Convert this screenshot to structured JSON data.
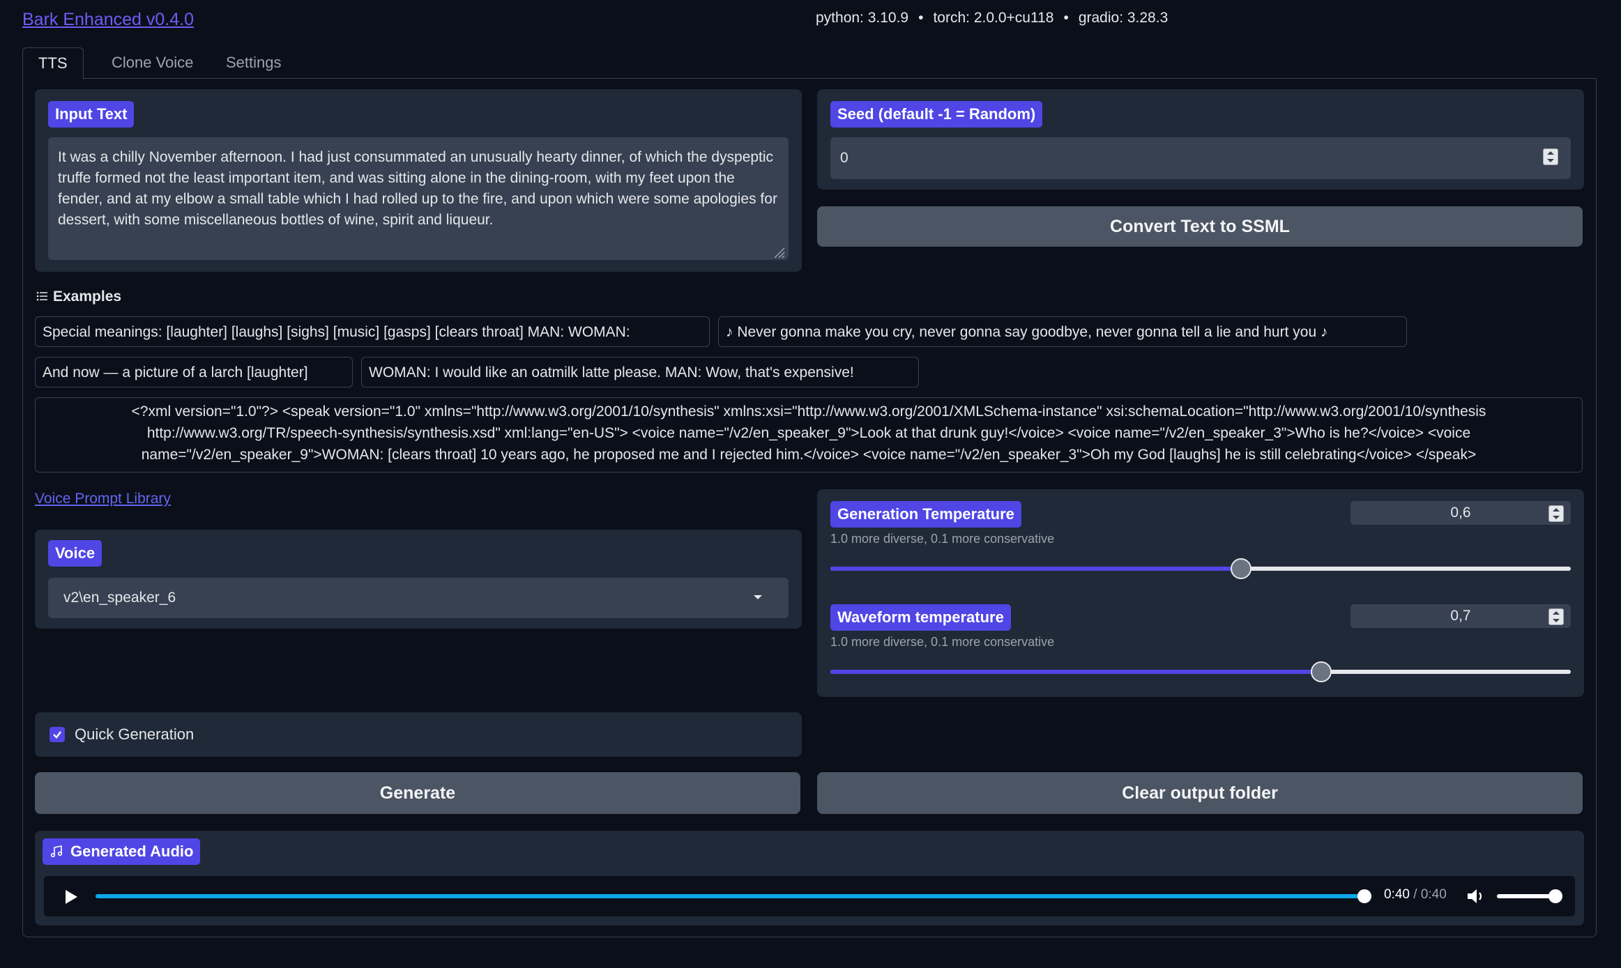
{
  "header": {
    "title": "Bark Enhanced v0.4.0",
    "versions": [
      "python: 3.10.9",
      "torch: 2.0.0+cu118",
      "gradio: 3.28.3"
    ],
    "separator": "•"
  },
  "tabs": [
    {
      "label": "TTS",
      "active": true
    },
    {
      "label": "Clone Voice",
      "active": false
    },
    {
      "label": "Settings",
      "active": false
    }
  ],
  "input_text": {
    "label": "Input Text",
    "value": "It was a chilly November afternoon. I had just consummated an unusually hearty dinner, of which the dyspeptic truffe formed not the least important item, and was sitting alone in the dining-room, with my feet upon the fender, and at my elbow a small table which I had rolled up to the fire, and upon which were some apologies for dessert, with some miscellaneous bottles of wine, spirit and liqueur."
  },
  "seed": {
    "label": "Seed (default -1 = Random)",
    "value": "0"
  },
  "convert_button": "Convert Text to SSML",
  "examples": {
    "label": "Examples",
    "items": [
      "Special meanings: [laughter] [laughs] [sighs] [music] [gasps] [clears throat] MAN: WOMAN:",
      "♪ Never gonna make you cry, never gonna say goodbye, never gonna tell a lie and hurt you ♪",
      "And now — a picture of a larch [laughter]",
      "WOMAN: I would like an oatmilk latte please. MAN: Wow, that's expensive!",
      "<?xml version=\"1.0\"?> <speak version=\"1.0\" xmlns=\"http://www.w3.org/2001/10/synthesis\" xmlns:xsi=\"http://www.w3.org/2001/XMLSchema-instance\" xsi:schemaLocation=\"http://www.w3.org/2001/10/synthesis http://www.w3.org/TR/speech-synthesis/synthesis.xsd\" xml:lang=\"en-US\"> <voice name=\"/v2/en_speaker_9\">Look at that drunk guy!</voice> <voice name=\"/v2/en_speaker_3\">Who is he?</voice> <voice name=\"/v2/en_speaker_9\">WOMAN: [clears throat] 10 years ago, he proposed me and I rejected him.</voice> <voice name=\"/v2/en_speaker_3\">Oh my God [laughs] he is still celebrating</voice> </speak>"
    ]
  },
  "voice_library_link": "Voice Prompt Library",
  "voice": {
    "label": "Voice",
    "selected": "v2\\en_speaker_6"
  },
  "generation_temperature": {
    "label": "Generation Temperature",
    "info": "1.0 more diverse, 0.1 more conservative",
    "value": "0,6",
    "fraction": 0.555
  },
  "waveform_temperature": {
    "label": "Waveform temperature",
    "info": "1.0 more diverse, 0.1 more conservative",
    "value": "0,7",
    "fraction": 0.663
  },
  "quick_generation": {
    "label": "Quick Generation",
    "checked": true
  },
  "generate_button": "Generate",
  "clear_button": "Clear output folder",
  "audio": {
    "label": "Generated Audio",
    "current_time": "0:40",
    "separator": "/",
    "total_time": "0:40",
    "progress": 1.0,
    "volume": 1.0
  },
  "colors": {
    "accent": "#4f46e5",
    "background": "#0b0f19",
    "block": "#1f2937",
    "audio_progress": "#0ea5e9"
  }
}
